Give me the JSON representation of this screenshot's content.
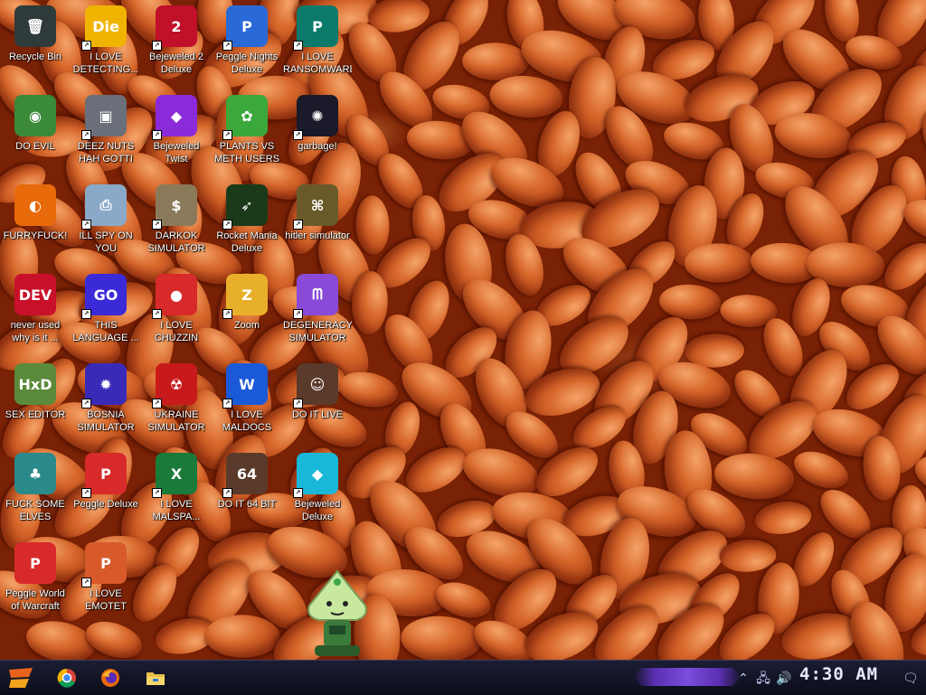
{
  "desktop": {
    "icons": [
      {
        "label": "Recycle Bin",
        "icon": "recycle-bin-icon",
        "color": "#2f3a3a",
        "glyph": "🗑"
      },
      {
        "label": "I LOVE DETECTING...",
        "icon": "detect-it-easy-icon",
        "color": "#f0b400",
        "glyph": "Die"
      },
      {
        "label": "Bejeweled 2 Deluxe",
        "icon": "bejeweled-2-icon",
        "color": "#c0102a",
        "glyph": "2"
      },
      {
        "label": "Peggle Nights Deluxe",
        "icon": "peggle-nights-icon",
        "color": "#2a6ad8",
        "glyph": "P"
      },
      {
        "label": "I LOVE RANSOMWARE",
        "icon": "publisher-icon",
        "color": "#0b7a6a",
        "glyph": "P"
      },
      {
        "label": "DO EVIL",
        "icon": "chrome-icon",
        "color": "#3a8a3a",
        "glyph": "◉"
      },
      {
        "label": "DEEZ NUTS HAH GOTTI",
        "icon": "windows-stack-icon",
        "color": "#6a6f7a",
        "glyph": "▣"
      },
      {
        "label": "Bejeweled Twist",
        "icon": "bejeweled-twist-icon",
        "color": "#8a2ad8",
        "glyph": "◆"
      },
      {
        "label": "PLANTS VS METH USERS",
        "icon": "plants-vs-zombies-icon",
        "color": "#3aa83a",
        "glyph": "✿"
      },
      {
        "label": "garbage!",
        "icon": "paradox-icon",
        "color": "#1a1a2a",
        "glyph": "✺"
      },
      {
        "label": "FURRYFUCK!",
        "icon": "firefox-icon",
        "color": "#e86a0a",
        "glyph": "◐"
      },
      {
        "label": "ILL SPY ON YOU",
        "icon": "network-computer-icon",
        "color": "#8aa8c8",
        "glyph": "⎙"
      },
      {
        "label": "DARKOK SIMULATOR",
        "icon": "money-bag-icon",
        "color": "#8a7a5a",
        "glyph": "$"
      },
      {
        "label": "Rocket Mania Deluxe",
        "icon": "rocket-mania-icon",
        "color": "#1a3a1a",
        "glyph": "➶"
      },
      {
        "label": "hitler simulator",
        "icon": "hoi-icon",
        "color": "#6a5a2a",
        "glyph": "⌘"
      },
      {
        "label": "never used why is it ...",
        "icon": "devcpp-icon",
        "color": "#c8102a",
        "glyph": "DEV"
      },
      {
        "label": "THIS LANGUAGE ...",
        "icon": "goland-icon",
        "color": "#3a2ad8",
        "glyph": "GO"
      },
      {
        "label": "I LOVE CHUZZIN",
        "icon": "chuzzle-icon",
        "color": "#d82a2a",
        "glyph": "●"
      },
      {
        "label": "Zoom",
        "icon": "zuma-icon",
        "color": "#e8b02a",
        "glyph": "Z"
      },
      {
        "label": "DEGENERACY SIMULATOR",
        "icon": "degeneracy-icon",
        "color": "#8a4ad8",
        "glyph": "ᗰ"
      },
      {
        "label": "SEX EDITOR",
        "icon": "hxd-icon",
        "color": "#5a8a3a",
        "glyph": "HxD"
      },
      {
        "label": "BOSNIA SIMULATOR",
        "icon": "spiked-mine-icon",
        "color": "#3a2ab8",
        "glyph": "✹"
      },
      {
        "label": "UKRAINE SIMULATOR",
        "icon": "radiation-icon",
        "color": "#c81a1a",
        "glyph": "☢"
      },
      {
        "label": "I LOVE MALDOCS",
        "icon": "word-icon",
        "color": "#1a5ad8",
        "glyph": "W"
      },
      {
        "label": "DO IT LIVE",
        "icon": "portrait-icon",
        "color": "#5a3a2a",
        "glyph": "☺"
      },
      {
        "label": "FUCK SOME ELVES",
        "icon": "santa-icon",
        "color": "#2a8a8a",
        "glyph": "♣"
      },
      {
        "label": "Peggle Deluxe",
        "icon": "peggle-icon",
        "color": "#d82a2a",
        "glyph": "P"
      },
      {
        "label": "I LOVE MALSPA...",
        "icon": "excel-icon",
        "color": "#1a7a3a",
        "glyph": "X"
      },
      {
        "label": "DO IT 64 BIT",
        "icon": "portrait-64-icon",
        "color": "#5a3a2a",
        "glyph": "64"
      },
      {
        "label": "Bejeweled Deluxe",
        "icon": "diamond-icon",
        "color": "#1ab8d8",
        "glyph": "◆"
      },
      {
        "label": "Peggle World of Warcraft Edition",
        "icon": "peggle-wow-icon",
        "color": "#d82a2a",
        "glyph": "P"
      },
      {
        "label": "I LOVE EMOTET",
        "icon": "powerpoint-icon",
        "color": "#d85a2a",
        "glyph": "P"
      }
    ]
  },
  "taskbar": {
    "apps": [
      {
        "name": "chrome",
        "icon": "chrome-icon",
        "color": "#2aa84a"
      },
      {
        "name": "firefox",
        "icon": "firefox-icon",
        "color": "#e86a0a"
      },
      {
        "name": "file explorer",
        "icon": "folder-icon",
        "color": "#e8c04a"
      }
    ],
    "clock": "4:30 AM",
    "accent": "#6a3ad8"
  }
}
